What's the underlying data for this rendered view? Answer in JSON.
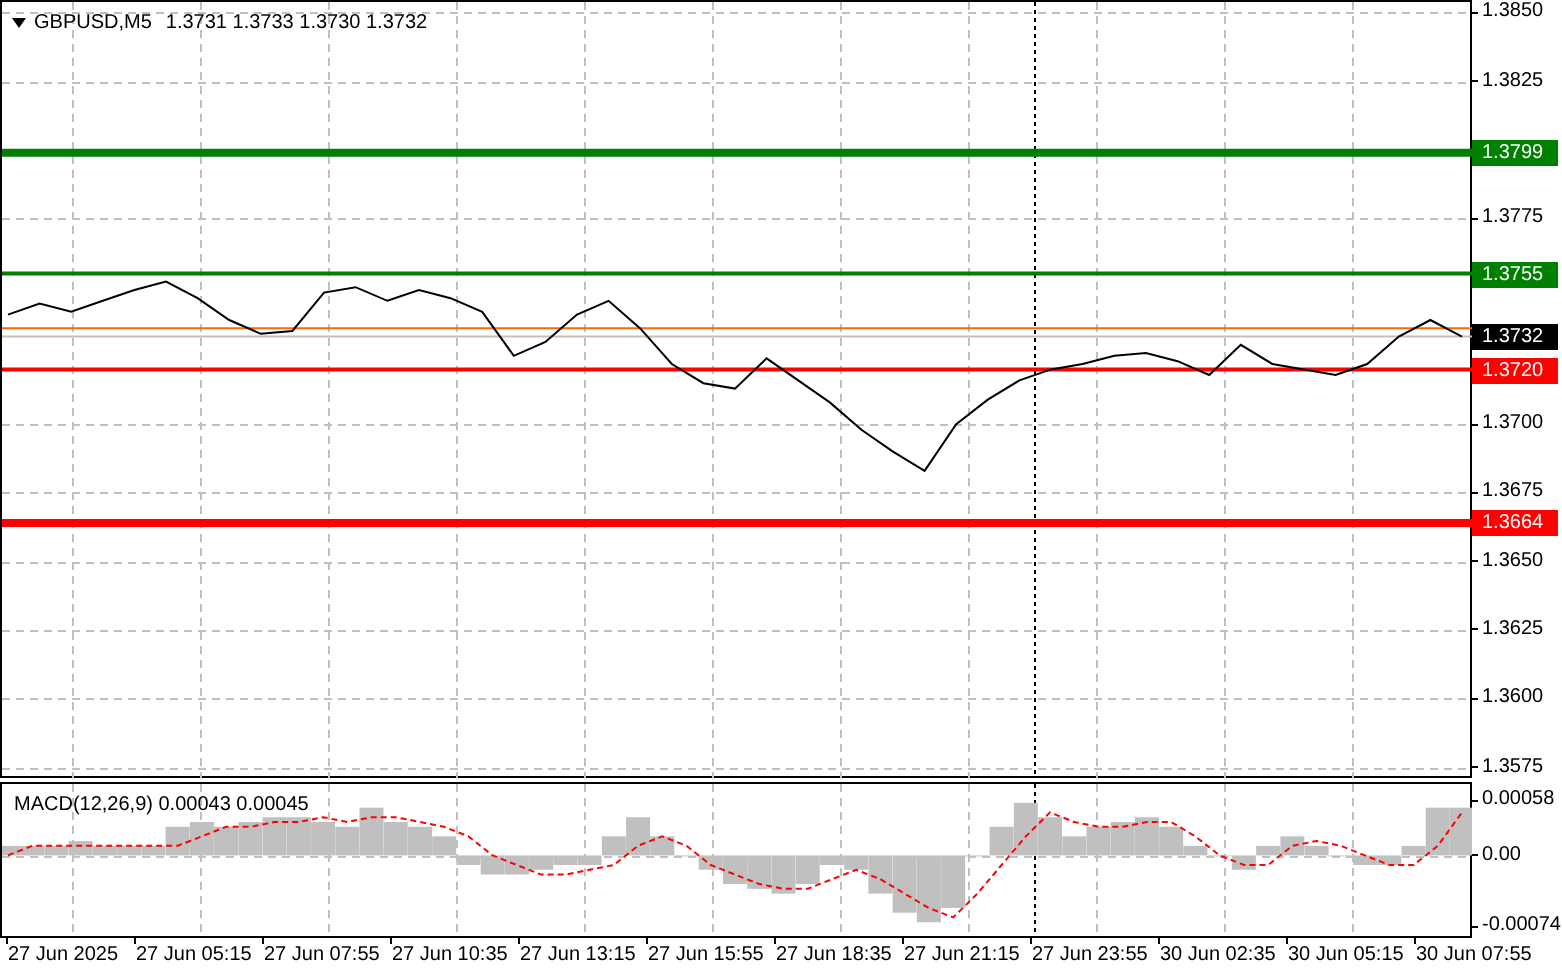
{
  "header": {
    "symbol": "GBPUSD,M5",
    "quotes": "1.3731 1.3733 1.3730 1.3732"
  },
  "price_chart": {
    "chart_data": {
      "type": "line",
      "grid": true,
      "ylim": [
        1.3571,
        1.3854
      ],
      "yticks": [
        {
          "value": 1.385,
          "label": "1.3850"
        },
        {
          "value": 1.3825,
          "label": "1.3825"
        },
        {
          "value": 1.3775,
          "label": "1.3775"
        },
        {
          "value": 1.37,
          "label": "1.3700"
        },
        {
          "value": 1.3675,
          "label": "1.3675"
        },
        {
          "value": 1.365,
          "label": "1.3650"
        },
        {
          "value": 1.3625,
          "label": "1.3625"
        },
        {
          "value": 1.36,
          "label": "1.3600"
        },
        {
          "value": 1.3575,
          "label": "1.3575"
        }
      ],
      "series": [
        {
          "color": "#000000",
          "values": [
            1.374,
            1.3744,
            1.3741,
            1.3745,
            1.3749,
            1.3752,
            1.3746,
            1.3738,
            1.3733,
            1.3734,
            1.3748,
            1.375,
            1.3745,
            1.3749,
            1.3746,
            1.3741,
            1.3725,
            1.373,
            1.374,
            1.3745,
            1.3735,
            1.3722,
            1.3715,
            1.3713,
            1.3724,
            1.3716,
            1.3708,
            1.3698,
            1.369,
            1.3683,
            1.37,
            1.3709,
            1.3716,
            1.372,
            1.3722,
            1.3725,
            1.3726,
            1.3723,
            1.3718,
            1.3729,
            1.3722,
            1.372,
            1.3718,
            1.3722,
            1.3732,
            1.3738,
            1.3732
          ]
        }
      ],
      "ref_lines": [
        {
          "axis": "y",
          "value": 1.3799,
          "label": "1.3799",
          "color": "#008000"
        },
        {
          "axis": "y",
          "value": 1.3755,
          "label": "1.3755",
          "color": "#008000"
        },
        {
          "axis": "y",
          "value": 1.3735,
          "color": "#ff6a00"
        },
        {
          "axis": "y",
          "value": 1.3732,
          "label": "1.3732",
          "color": "#c0c0c0"
        },
        {
          "axis": "y",
          "value": 1.372,
          "label": "1.3720",
          "color": "#ff0000"
        },
        {
          "axis": "y",
          "value": 1.3664,
          "label": "1.3664",
          "color": "#ff0000"
        }
      ]
    }
  },
  "macd": {
    "title": "MACD(12,26,9) 0.00043 0.00045",
    "chart_data": {
      "type": "bar",
      "grid": true,
      "ylim": [
        -0.000865,
        0.000748
      ],
      "yticks": [
        {
          "value": 0.00058,
          "label": "0.00058"
        },
        {
          "value": 0,
          "label": "0.00"
        },
        {
          "value": -0.00074,
          "label": "-0.00074"
        }
      ],
      "series": [
        {
          "type": "bar",
          "color": "#c0c0c0",
          "values": [
            0.0001,
            0.0001,
            0.0001,
            0.00015,
            0.0001,
            0.0001,
            0.0001,
            0.0003,
            0.00035,
            0.0003,
            0.00035,
            0.0004,
            0.0004,
            0.00035,
            0.0003,
            0.0005,
            0.00035,
            0.0003,
            0.0002,
            -0.0001,
            -0.0002,
            -0.0002,
            -0.00015,
            -0.0001,
            -0.0001,
            0.0002,
            0.0004,
            0.0002,
            0.0,
            -0.00015,
            -0.0003,
            -0.00035,
            -0.0004,
            -0.0003,
            -0.0001,
            -0.00015,
            -0.0004,
            -0.0006,
            -0.0007,
            -0.00055,
            0.0,
            0.0003,
            0.00055,
            0.0004,
            0.0002,
            0.0003,
            0.00035,
            0.0004,
            0.0003,
            0.0001,
            0.0,
            -0.00015,
            0.0001,
            0.0002,
            0.0001,
            0.0,
            -0.0001,
            -0.0001,
            0.0001,
            0.0005,
            0.0005
          ]
        },
        {
          "type": "line",
          "line_style": "dashed",
          "color": "#ff0000",
          "values": [
            0.0,
            0.0001,
            0.0001,
            0.0001,
            0.0001,
            0.0001,
            0.0001,
            0.0001,
            0.0002,
            0.0003,
            0.0003,
            0.00035,
            0.00035,
            0.0004,
            0.00035,
            0.0004,
            0.0004,
            0.00035,
            0.0003,
            0.0002,
            0.0,
            -0.0001,
            -0.0002,
            -0.0002,
            -0.00015,
            -0.0001,
            0.0001,
            0.0002,
            0.0001,
            -0.0001,
            -0.0002,
            -0.0003,
            -0.00035,
            -0.00035,
            -0.00025,
            -0.00015,
            -0.00025,
            -0.0004,
            -0.00055,
            -0.00065,
            -0.0004,
            -0.0001,
            0.0002,
            0.00045,
            0.00035,
            0.0003,
            0.0003,
            0.00035,
            0.00035,
            0.0002,
            0.0,
            -0.0001,
            -0.0001,
            0.0001,
            0.00015,
            0.0001,
            0.0,
            -0.0001,
            -0.0001,
            0.0001,
            0.00045
          ]
        }
      ]
    }
  },
  "time_axis": [
    "27 Jun 2025",
    "27 Jun 05:15",
    "27 Jun 07:55",
    "27 Jun 10:35",
    "27 Jun 13:15",
    "27 Jun 15:55",
    "27 Jun 18:35",
    "27 Jun 21:15",
    "27 Jun 23:55",
    "30 Jun 02:35",
    "30 Jun 05:15",
    "30 Jun 07:55"
  ]
}
